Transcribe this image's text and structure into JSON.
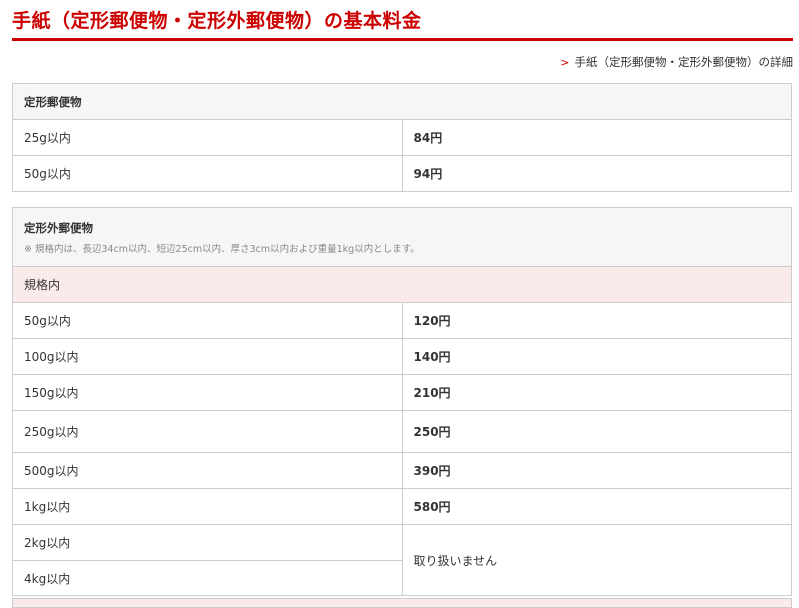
{
  "title": "手紙（定形郵便物・定形外郵便物）の基本料金",
  "detail_link": "手紙（定形郵便物・定形外郵便物）の詳細",
  "teikei": {
    "header": "定形郵便物",
    "rows": [
      {
        "weight": "25g以内",
        "price": "84円"
      },
      {
        "weight": "50g以内",
        "price": "94円"
      }
    ]
  },
  "teikeigai": {
    "header": "定形外郵便物",
    "note": "※ 規格内は、長辺34cm以内、短辺25cm以内、厚さ3cm以内および重量1kg以内とします。",
    "sub_header": "規格内",
    "rows": [
      {
        "weight": "50g以内",
        "price": "120円"
      },
      {
        "weight": "100g以内",
        "price": "140円"
      },
      {
        "weight": "150g以内",
        "price": "210円"
      },
      {
        "weight": "250g以内",
        "price": "250円"
      },
      {
        "weight": "500g以内",
        "price": "390円"
      },
      {
        "weight": "1kg以内",
        "price": "580円"
      },
      {
        "weight": "2kg以内"
      },
      {
        "weight": "4kg以内"
      }
    ],
    "not_handled": "取り扱いません"
  },
  "colors": {
    "accent": "#cc0000",
    "header_bg": "#f6f6f6",
    "sub_header_bg": "#fbeaea",
    "border": "#cccccc"
  },
  "icons": {
    "link_chevron": "chevron-right-icon"
  }
}
